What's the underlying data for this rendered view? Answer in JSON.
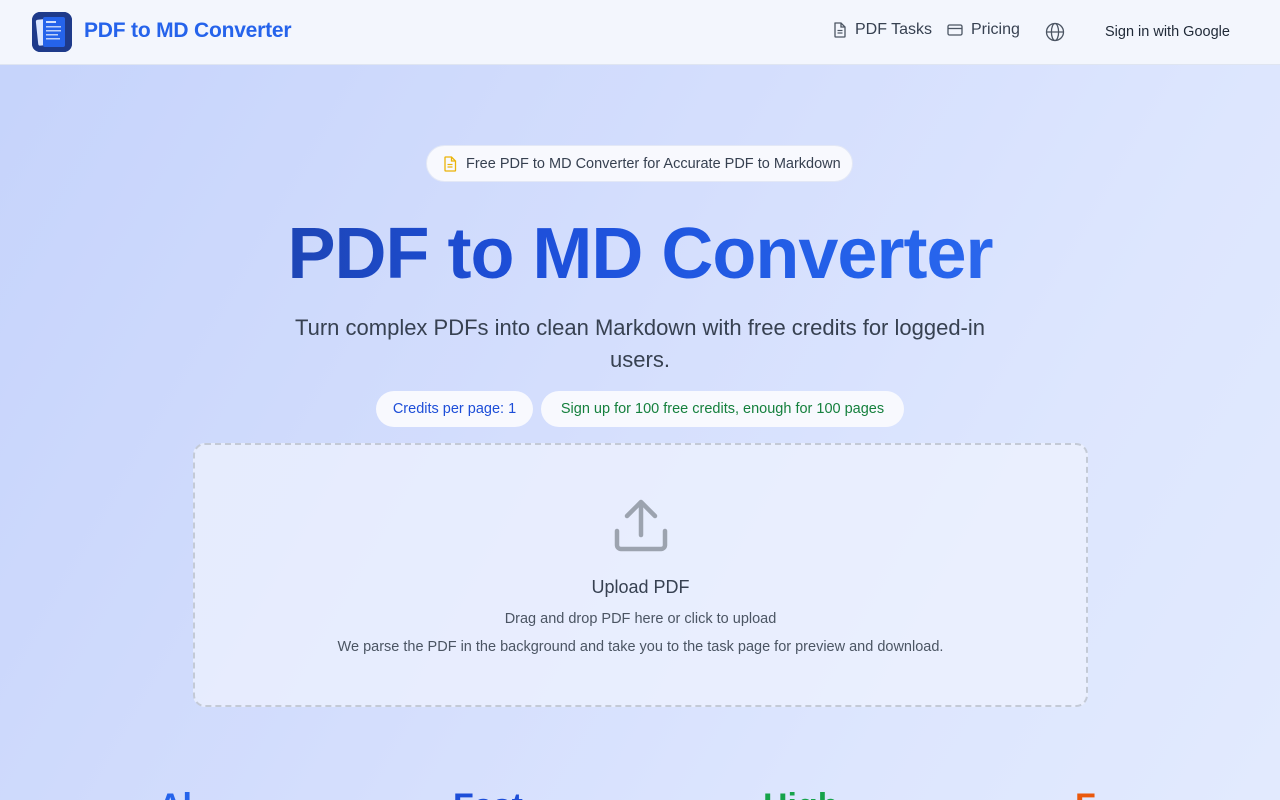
{
  "header": {
    "brand": "PDF to MD Converter",
    "logo_icon": "document-stack-icon",
    "nav": [
      {
        "label": "PDF Tasks",
        "icon": "document-icon"
      },
      {
        "label": "Pricing",
        "icon": "credit-card-icon"
      }
    ],
    "language_icon": "globe-icon",
    "signin_label": "Sign in with Google"
  },
  "hero": {
    "badge_icon": "file-text-icon",
    "badge_text": "Free PDF to MD Converter for Accurate PDF to Markdown",
    "title": "PDF to MD Converter",
    "subtitle": "Turn complex PDFs into clean Markdown with free credits for logged-in users.",
    "credits_chip": "Credits per page: 1",
    "signup_chip": "Sign up for 100 free credits, enough for 100 pages"
  },
  "upload": {
    "icon": "upload-icon",
    "title": "Upload PDF",
    "description": "Drag and drop PDF here or click to upload",
    "note": "We parse the PDF in the background and take you to the task page for preview and download."
  },
  "features_peek": [
    {
      "text": "Al",
      "color": "#2563eb"
    },
    {
      "text": "Fast",
      "color": "#1d4ed8"
    },
    {
      "text": "High",
      "color": "#16a34a"
    },
    {
      "text": "F",
      "color": "#ea580c"
    }
  ],
  "colors": {
    "accent": "#2563eb",
    "success": "#15803d"
  }
}
